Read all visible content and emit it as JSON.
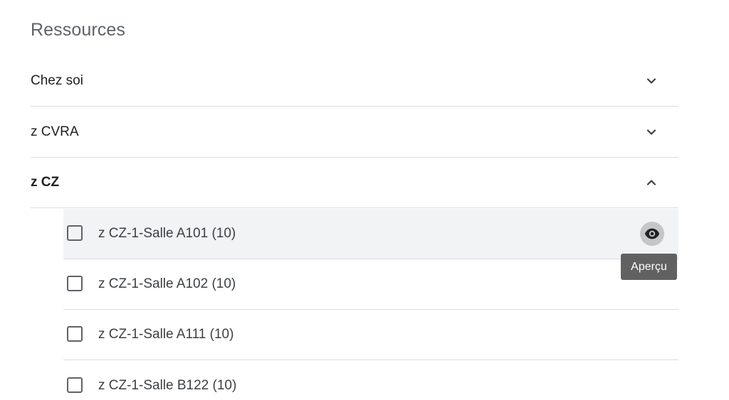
{
  "section": {
    "title": "Ressources"
  },
  "groups": [
    {
      "label": "Chez soi",
      "state": "collapsed",
      "icon": "chevron-down-icon"
    },
    {
      "label": "z CVRA",
      "state": "collapsed",
      "icon": "chevron-down-icon"
    },
    {
      "label": "z CZ",
      "state": "expanded",
      "icon": "chevron-up-icon"
    }
  ],
  "resources": [
    {
      "label": "z CZ-1-Salle A101 (10)",
      "checked": false,
      "hovered": true
    },
    {
      "label": "z CZ-1-Salle A102 (10)",
      "checked": false,
      "hovered": false
    },
    {
      "label": "z CZ-1-Salle A111 (10)",
      "checked": false,
      "hovered": false
    },
    {
      "label": "z CZ-1-Salle B122 (10)",
      "checked": false,
      "hovered": false
    }
  ],
  "preview": {
    "icon": "eye-icon",
    "tooltip": "Aperçu"
  },
  "colors": {
    "title": "#5f6368",
    "divider": "#dadce0",
    "hover_row": "#f1f3f4",
    "tooltip_bg": "#616161"
  }
}
